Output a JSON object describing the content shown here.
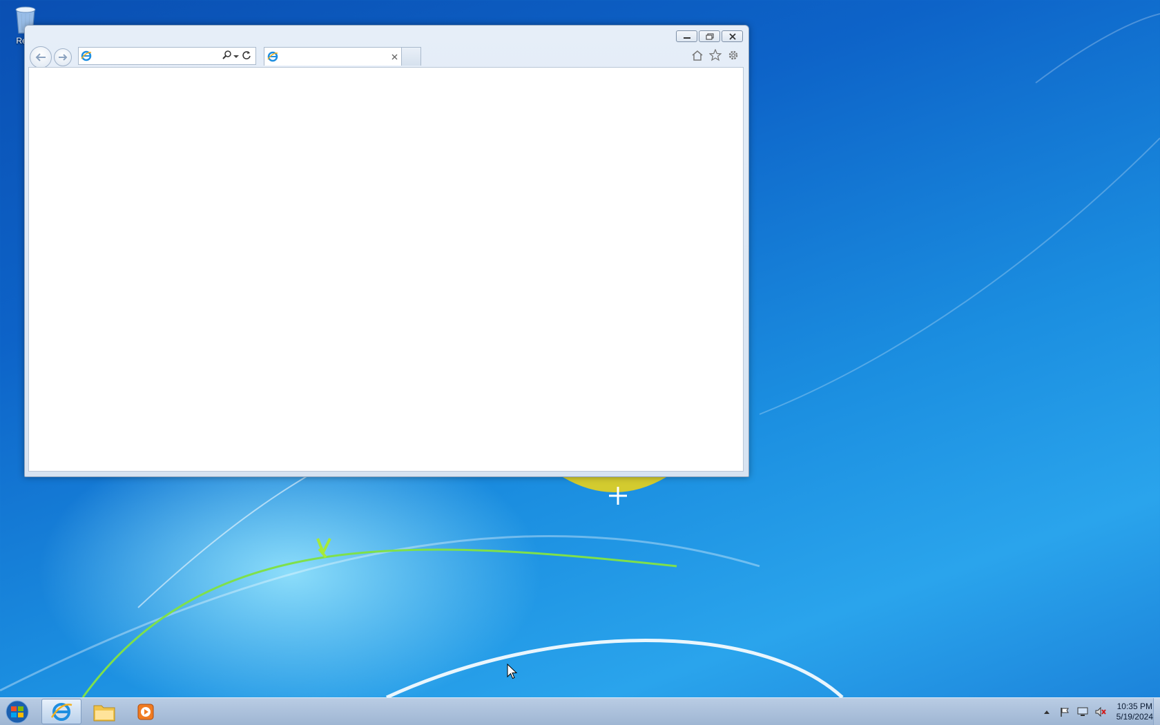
{
  "desktop": {
    "icons": [
      {
        "label": "Recy",
        "icon": "recycle-bin-icon"
      }
    ]
  },
  "browser": {
    "address_value": "",
    "tab_title": "",
    "icons": {
      "back": "back-arrow-icon",
      "forward": "forward-arrow-icon",
      "search": "search-icon",
      "refresh": "refresh-icon",
      "home": "home-icon",
      "favorites": "star-icon",
      "tools": "gear-icon",
      "close_tab": "close-icon"
    }
  },
  "taskbar": {
    "items": [
      {
        "name": "internet-explorer",
        "icon": "ie-icon",
        "active": true
      },
      {
        "name": "file-explorer",
        "icon": "folder-icon",
        "active": false
      },
      {
        "name": "media-player",
        "icon": "media-player-icon",
        "active": false
      }
    ],
    "clock": {
      "time": "10:35 PM",
      "date": "5/19/2024"
    }
  },
  "colors": {
    "desktop_blue": "#0d63c8",
    "taskbar": "#b9cce4",
    "window_frame": "#dde6f1"
  }
}
